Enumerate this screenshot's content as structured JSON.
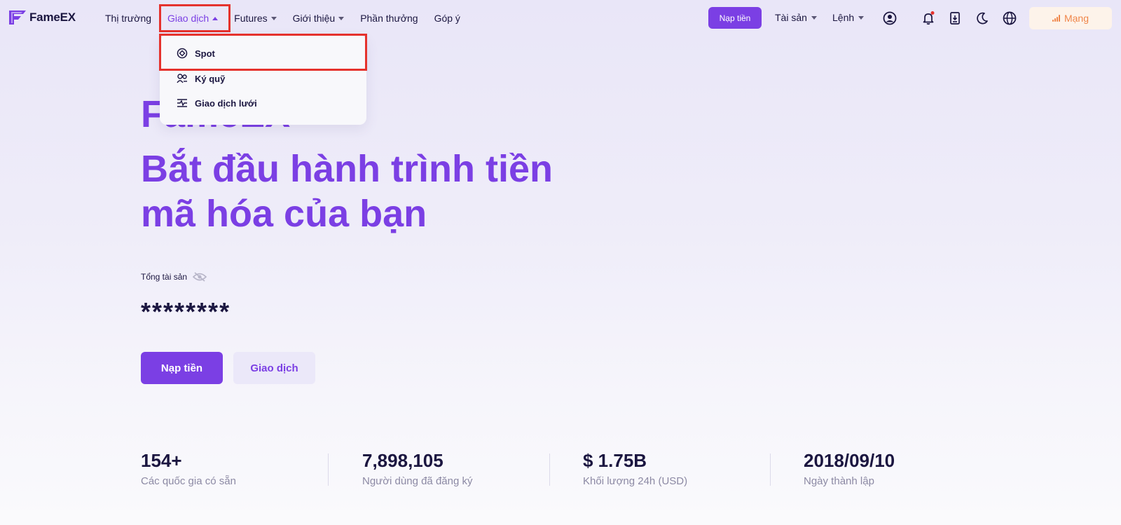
{
  "colors": {
    "accent": "#7b3fe4",
    "text": "#1b1640",
    "muted": "#8c89a4",
    "highlight": "#e5322d",
    "network": "#f0864a"
  },
  "brand": {
    "name": "FameEX"
  },
  "nav": {
    "items": [
      {
        "label": "Thị trường"
      },
      {
        "label": "Giao dịch"
      },
      {
        "label": "Futures"
      },
      {
        "label": "Giới thiệu"
      },
      {
        "label": "Phần thưởng"
      },
      {
        "label": "Góp ý"
      }
    ],
    "deposit_label": "Nạp tiền",
    "assets_label": "Tài sản",
    "orders_label": "Lệnh",
    "icons": [
      "user-icon",
      "bell-icon",
      "download-icon",
      "moon-icon",
      "globe-icon"
    ],
    "network_label": "Mạng"
  },
  "dropdown": {
    "items": [
      {
        "label": "Spot",
        "icon": "spot-icon"
      },
      {
        "label": "Ký quỹ",
        "icon": "margin-icon"
      },
      {
        "label": "Giao dịch lưới",
        "icon": "grid-trading-icon"
      }
    ]
  },
  "hero": {
    "line1": "FameEX",
    "line2": "Bắt đầu hành trình tiền",
    "line3": "mã hóa của bạn",
    "assets_label": "Tổng tài sản",
    "masked_value": "********",
    "deposit_button": "Nạp tiền",
    "trade_button": "Giao dịch"
  },
  "stats": [
    {
      "value": "154+",
      "label": "Các quốc gia có sẵn"
    },
    {
      "value": "7,898,105",
      "label": "Người dùng đã đăng ký"
    },
    {
      "value": "$ 1.75B",
      "label": "Khối lượng 24h (USD)"
    },
    {
      "value": "2018/09/10",
      "label": "Ngày thành lập"
    }
  ]
}
